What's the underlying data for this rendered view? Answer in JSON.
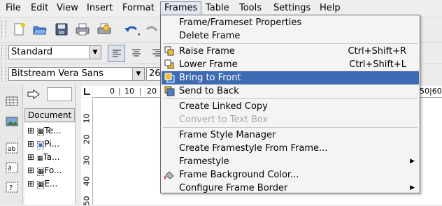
{
  "menubar": [
    "File",
    "Edit",
    "View",
    "Insert",
    "Format",
    "Frames",
    "Table",
    "Tools",
    "Settings",
    "Help"
  ],
  "toolbar2": {
    "style_value": "Standard"
  },
  "toolbar3": {
    "font_value": "Bitstream Vera Sans",
    "size_value": "26"
  },
  "navigator": {
    "header": "Document",
    "items": [
      "Te...",
      "Pi...",
      "Ta...",
      "Fo...",
      "E..."
    ]
  },
  "hruler": {
    "ticks": [
      "0",
      "10",
      "20"
    ],
    "right_tick": "50|60"
  },
  "vruler": {
    "ticks": [
      "10",
      "20",
      "30",
      "40",
      "50"
    ]
  },
  "frames_menu": {
    "items": [
      {
        "label": "Frame/Frameset Properties",
        "shortcut": ""
      },
      {
        "label": "Delete Frame",
        "shortcut": ""
      },
      {
        "label": "Raise Frame",
        "shortcut": "Ctrl+Shift+R"
      },
      {
        "label": "Lower Frame",
        "shortcut": "Ctrl+Shift+L"
      },
      {
        "label": "Bring to Front",
        "shortcut": ""
      },
      {
        "label": "Send to Back",
        "shortcut": ""
      },
      {
        "label": "Create Linked Copy",
        "shortcut": ""
      },
      {
        "label": "Convert to Text Box",
        "shortcut": ""
      },
      {
        "label": "Frame Style Manager",
        "shortcut": ""
      },
      {
        "label": "Create Framestyle From Frame...",
        "shortcut": ""
      },
      {
        "label": "Framestyle",
        "shortcut": ""
      },
      {
        "label": "Frame Background Color...",
        "shortcut": ""
      },
      {
        "label": "Configure Frame Border",
        "shortcut": ""
      }
    ]
  },
  "colors": {
    "highlight": "#3d6ab3",
    "menu_bg": "#f4f4f4"
  }
}
